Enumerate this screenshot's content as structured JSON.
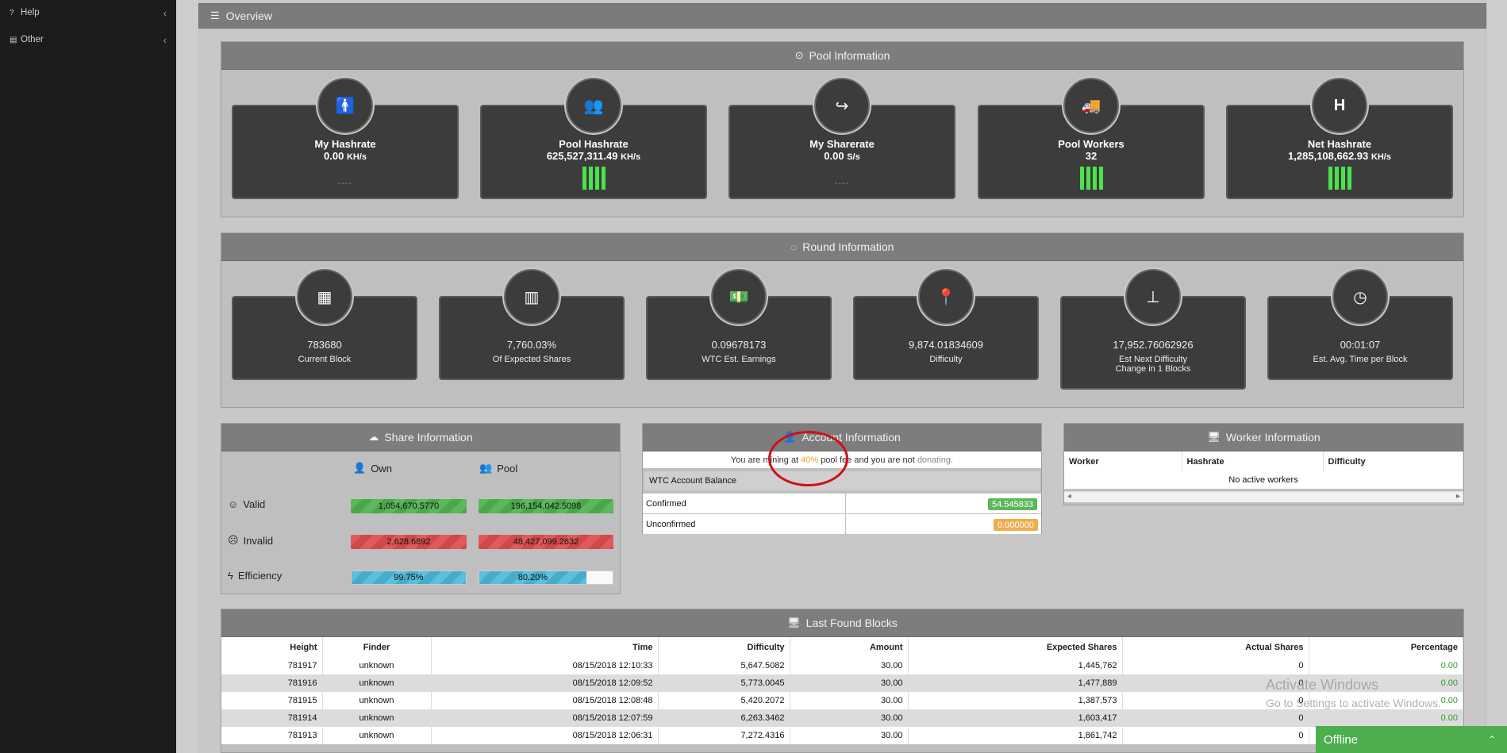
{
  "sidebar": {
    "items": [
      {
        "label": "Help",
        "icon": "question-icon"
      },
      {
        "label": "Other",
        "icon": "list-icon"
      }
    ]
  },
  "overview": {
    "title": "Overview"
  },
  "pool_info": {
    "title": "Pool Information",
    "stats": [
      {
        "title": "My Hashrate",
        "value": "0.00",
        "unit": "KH/s",
        "spark": "----"
      },
      {
        "title": "Pool Hashrate",
        "value": "625,527,311.49",
        "unit": "KH/s",
        "spark": ""
      },
      {
        "title": "My Sharerate",
        "value": "0.00",
        "unit": "S/s",
        "spark": "----"
      },
      {
        "title": "Pool Workers",
        "value": "32",
        "unit": "",
        "spark": ""
      },
      {
        "title": "Net Hashrate",
        "value": "1,285,108,662.93",
        "unit": "KH/s",
        "spark": ""
      }
    ]
  },
  "round_info": {
    "title": "Round Information",
    "stats": [
      {
        "value": "783680",
        "label": "Current Block"
      },
      {
        "value": "7,760.03%",
        "label": "Of Expected Shares"
      },
      {
        "value": "0.09678173",
        "label": "WTC Est. Earnings"
      },
      {
        "value": "9,874.01834609",
        "label": "Difficulty"
      },
      {
        "value": "17,952.76062926",
        "label": "Est Next Difficulty",
        "label2": "Change in 1 Blocks"
      },
      {
        "value": "00:01:07",
        "label": "Est. Avg. Time per Block"
      }
    ]
  },
  "share_info": {
    "title": "Share Information",
    "col_own": "Own",
    "col_pool": "Pool",
    "valid_label": "Valid",
    "invalid_label": "Invalid",
    "efficiency_label": "Efficiency",
    "valid_own": "1,054,670.5770",
    "valid_pool": "196,154,042.5098",
    "invalid_own": "2,628.6892",
    "invalid_pool": "48,427,099.2632",
    "efficiency_own": "99.75%",
    "efficiency_pool": "80.20%",
    "efficiency_own_fraction": 0.9975,
    "efficiency_pool_fraction": 0.802
  },
  "account_info": {
    "title": "Account Information",
    "notice_a": "You are mining at",
    "notice_fee": "40%",
    "notice_b": "pool fee and you are not",
    "notice_c": "donating.",
    "balance_header": "WTC Account Balance",
    "confirmed_label": "Confirmed",
    "confirmed_value": "54.545833",
    "unconfirmed_label": "Unconfirmed",
    "unconfirmed_value": "0.000000"
  },
  "worker_info": {
    "title": "Worker Information",
    "columns": [
      "Worker",
      "Hashrate",
      "Difficulty"
    ],
    "empty": "No active workers"
  },
  "last_blocks": {
    "title": "Last Found Blocks",
    "columns": [
      "Height",
      "Finder",
      "Time",
      "Difficulty",
      "Amount",
      "Expected Shares",
      "Actual Shares",
      "Percentage"
    ],
    "rows": [
      [
        "781917",
        "unknown",
        "08/15/2018 12:10:33",
        "5,647.5082",
        "30.00",
        "1,445,762",
        "0",
        "0.00"
      ],
      [
        "781916",
        "unknown",
        "08/15/2018 12:09:52",
        "5,773.0045",
        "30.00",
        "1,477,889",
        "0",
        "0.00"
      ],
      [
        "781915",
        "unknown",
        "08/15/2018 12:08:48",
        "5,420.2072",
        "30.00",
        "1,387,573",
        "0",
        "0.00"
      ],
      [
        "781914",
        "unknown",
        "08/15/2018 12:07:59",
        "6,263.3462",
        "30.00",
        "1,603,417",
        "0",
        "0.00"
      ],
      [
        "781913",
        "unknown",
        "08/15/2018 12:06:31",
        "7,272.4316",
        "30.00",
        "1,861,742",
        "0",
        "0.00"
      ]
    ]
  },
  "watermark": {
    "line1": "Activate Windows",
    "line2": "Go to Settings to activate Windows."
  },
  "status": {
    "label": "Offline"
  },
  "colors": {
    "success": "#5cb85c",
    "danger": "#d9534f",
    "info": "#5bc0de",
    "warning": "#f0ad4e",
    "annotation": "#d0101a"
  }
}
